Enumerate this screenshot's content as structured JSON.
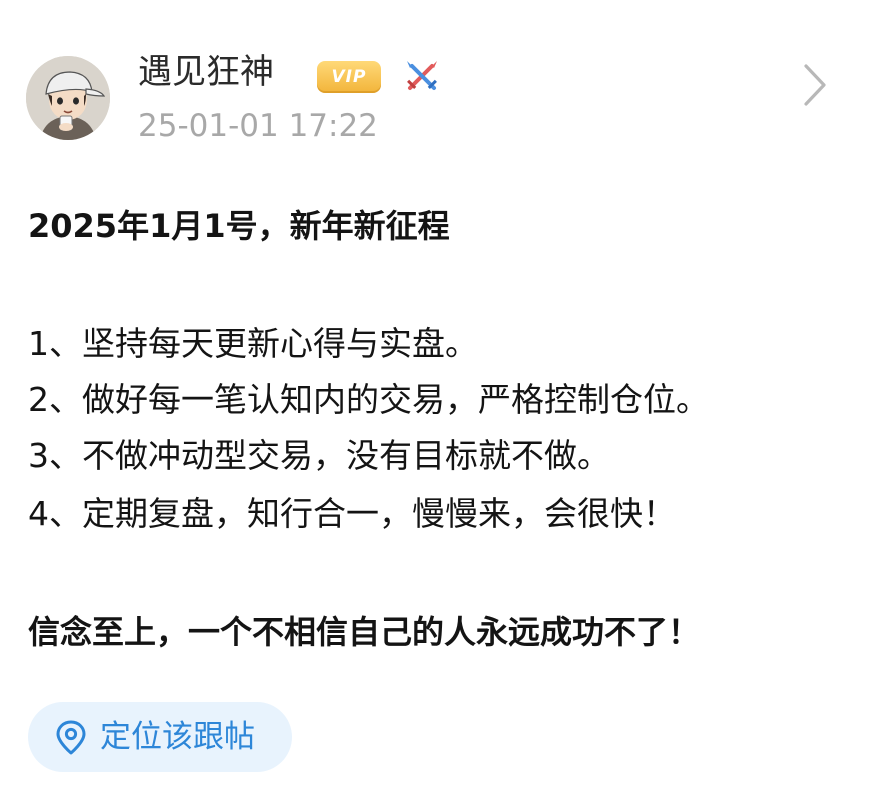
{
  "post": {
    "author": {
      "name": "遇见狂神",
      "badge": "VIP",
      "badge_icon": "crossed-swords-icon"
    },
    "timestamp": "25-01-01 17:22",
    "title_line": "2025年1月1号，新年新征程",
    "items": [
      "1、坚持每天更新心得与实盘。",
      "2、做好每一笔认知内的交易，严格控制仓位。",
      "3、不做冲动型交易，没有目标就不做。",
      "4、定期复盘，知行合一，慢慢来，会很快！"
    ],
    "closing_line": "信念至上，一个不相信自己的人永远成功不了！"
  },
  "action": {
    "locate_label": "定位该跟帖",
    "icon": "location-pin-icon"
  },
  "colors": {
    "vip_gold": "#f2b43a",
    "timestamp_gray": "#a8a8a8",
    "link_blue": "#2d86d8",
    "button_bg": "#e8f3fd"
  }
}
